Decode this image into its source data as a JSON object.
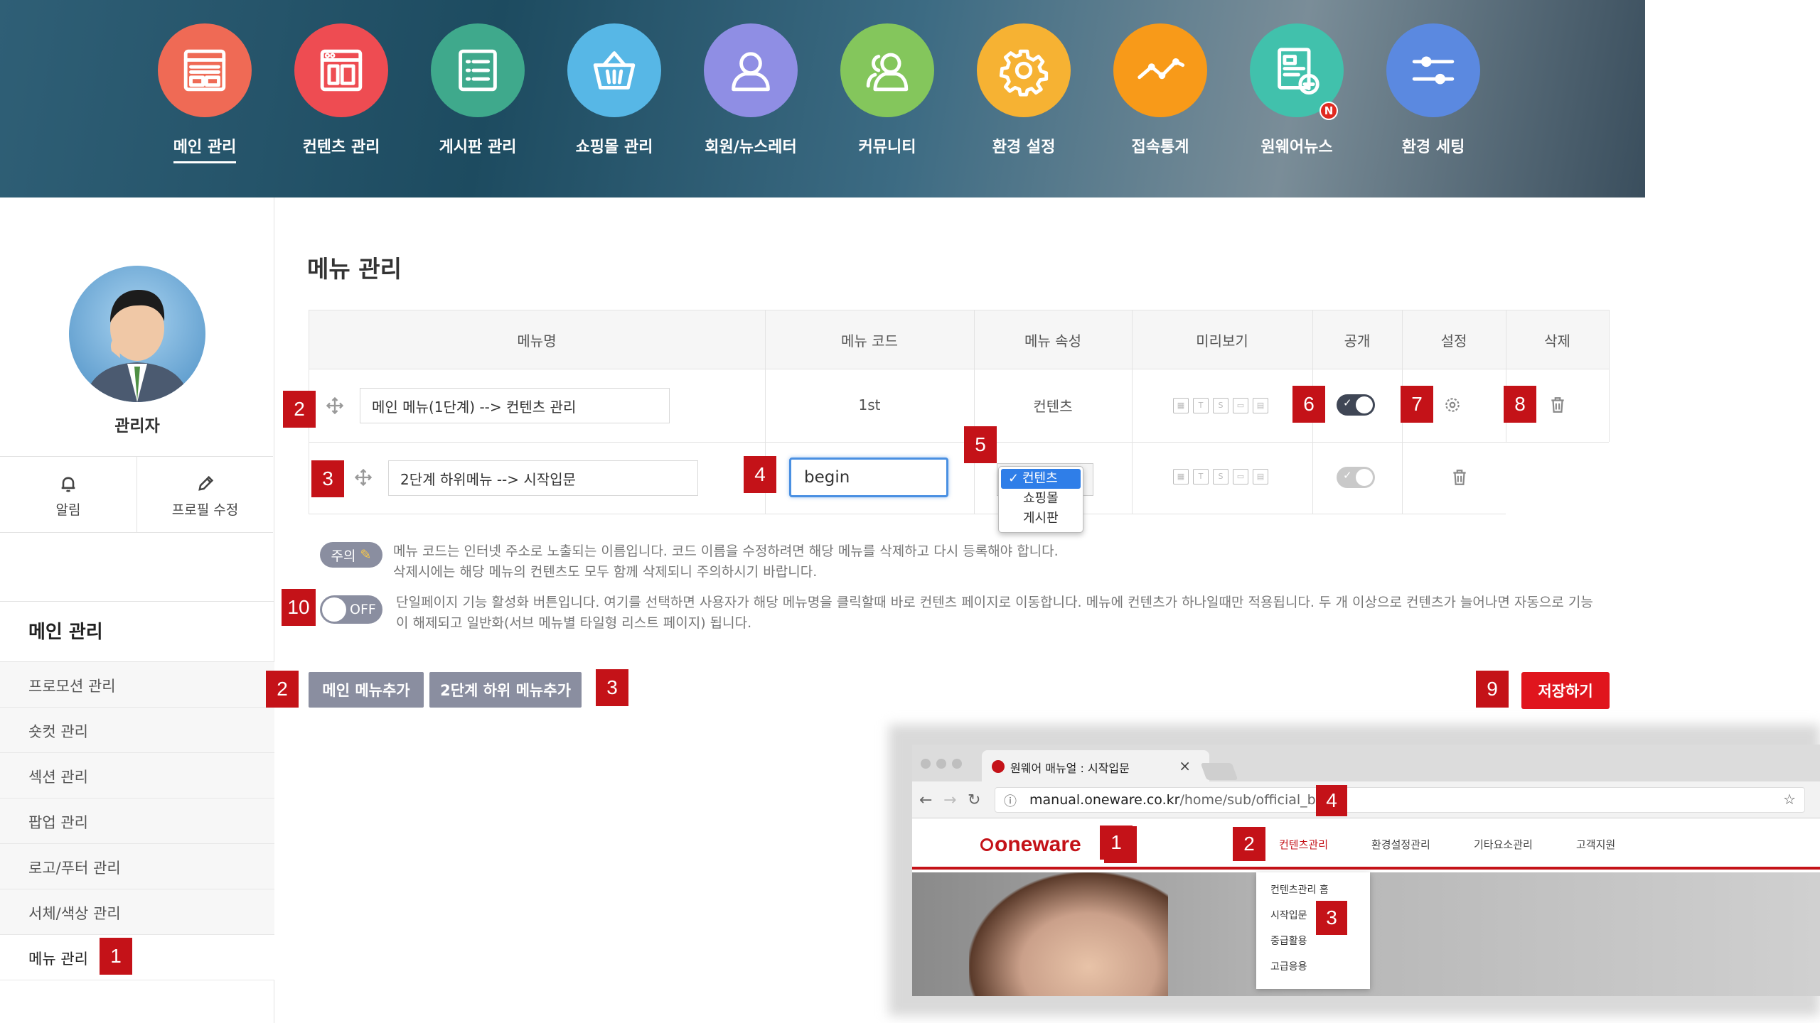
{
  "header": {
    "nav": [
      {
        "label": "메인 관리",
        "icon": "layout-icon",
        "color": "#ef6a55",
        "active": true
      },
      {
        "label": "컨텐츠 관리",
        "icon": "content-icon",
        "color": "#ee4c52"
      },
      {
        "label": "게시판 관리",
        "icon": "list-icon",
        "color": "#3fa98c"
      },
      {
        "label": "쇼핑몰 관리",
        "icon": "basket-icon",
        "color": "#57b7e6"
      },
      {
        "label": "회원/뉴스레터",
        "icon": "user-icon",
        "color": "#8f8ee4"
      },
      {
        "label": "커뮤니티",
        "icon": "users-icon",
        "color": "#84c65c"
      },
      {
        "label": "환경 설정",
        "icon": "gear-icon",
        "color": "#f6b233"
      },
      {
        "label": "접속통계",
        "icon": "chart-line-icon",
        "color": "#f89a19"
      },
      {
        "label": "원웨어뉴스",
        "icon": "news-icon",
        "color": "#41c1ac",
        "badge": "N"
      },
      {
        "label": "환경 세팅",
        "icon": "sliders-icon",
        "color": "#5b89e0"
      }
    ]
  },
  "sidebar": {
    "admin_name": "관리자",
    "btn_alert": "알림",
    "btn_profile": "프로필 수정",
    "menu_title": "메인 관리",
    "items": [
      "프로모션 관리",
      "숏컷 관리",
      "섹션 관리",
      "팝업 관리",
      "로고/푸터 관리",
      "서체/색상 관리",
      "메뉴 관리"
    ]
  },
  "main": {
    "title": "메뉴 관리",
    "table": {
      "headers": [
        "메뉴명",
        "메뉴 코드",
        "메뉴 속성",
        "미리보기",
        "공개",
        "설정",
        "삭제"
      ],
      "row1": {
        "name": "메인 메뉴(1단계)  --> 컨텐츠 관리",
        "code": "1st",
        "attr": "컨텐츠"
      },
      "row2": {
        "name": "2단계 하위메뉴  --> 시작입문",
        "code": "begin"
      }
    },
    "attr_options": [
      "컨텐츠",
      "쇼핑몰",
      "게시판"
    ],
    "note_badge": "주의",
    "note_lines": [
      "메뉴 코드는 인터넷 주소로 노출되는 이름입니다. 코드 이름을 수정하려면 해당 메뉴를 삭제하고 다시 등록해야 합니다.",
      "삭제시에는 해당 메뉴의 컨텐츠도 모두 함께 삭제되니 주의하시기 바랍니다."
    ],
    "toggle_off": "OFF",
    "single_page_lines": [
      "단일페이지 기능 활성화 버튼입니다. 여기를 선택하면 사용자가 해당 메뉴명을 클릭할때 바로 컨텐츠 페이지로 이동합니다. 메뉴에 컨텐츠가 하나일때만 적용됩니다. 두 개 이상으로 컨텐츠가 늘어나면 자동으로 기능",
      "이 해제되고 일반화(서브 메뉴별 타일형 리스트 페이지) 됩니다."
    ],
    "btn_add_main": "메인 메뉴추가",
    "btn_add_sub": "2단계 하위 메뉴추가",
    "btn_save": "저장하기"
  },
  "markers": [
    "1",
    "2",
    "3",
    "4",
    "5",
    "6",
    "7",
    "8",
    "9",
    "10"
  ],
  "browser": {
    "tab_title": "원웨어 매뉴얼 : 시작입문",
    "url_domain": "manual.oneware.co.kr",
    "url_path": "/home/sub/official_begin",
    "logo": "oneware",
    "nav": [
      "컨텐츠관리",
      "환경설정관리",
      "기타요소관리",
      "고객지원"
    ],
    "dropdown": [
      "컨텐츠관리 홈",
      "시작입문",
      "중급활용",
      "고급응용"
    ]
  },
  "colors": {
    "accent": "#c41218",
    "save": "#e0151d",
    "gray_btn": "#8a8ea0",
    "focus": "#4a90e2"
  }
}
